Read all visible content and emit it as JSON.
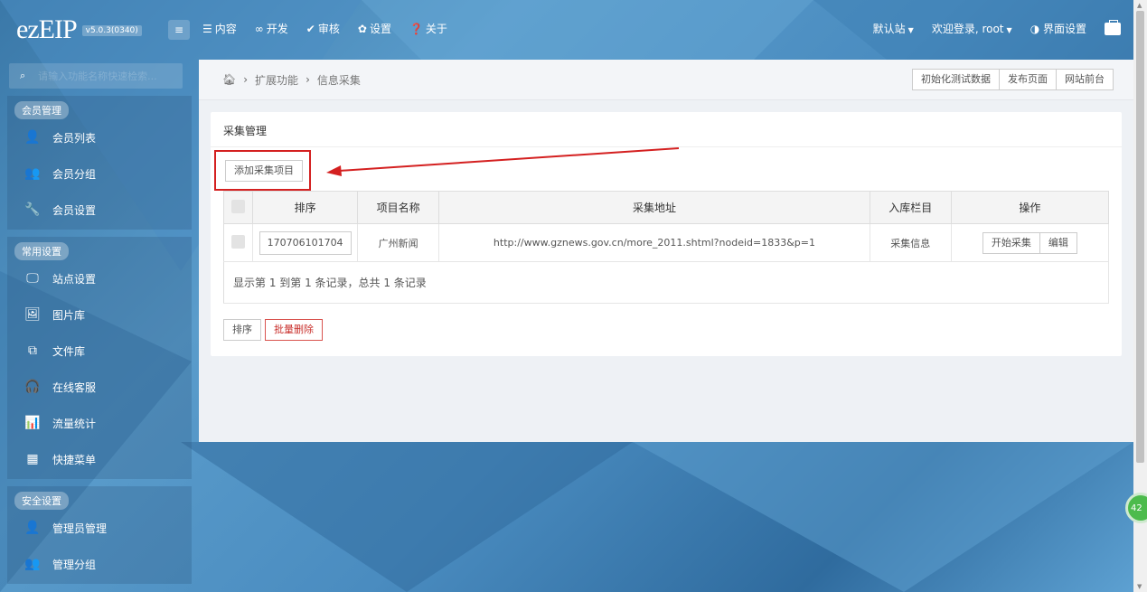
{
  "header": {
    "logo": "ezEIP",
    "version": "v5.0.3(0340)",
    "nav": [
      {
        "icon": "list-icon",
        "glyph": "☰",
        "label": "内容"
      },
      {
        "icon": "infinity-icon",
        "glyph": "∞",
        "label": "开发"
      },
      {
        "icon": "check-icon",
        "glyph": "✔",
        "label": "审核"
      },
      {
        "icon": "gear-icon",
        "glyph": "✿",
        "label": "设置"
      },
      {
        "icon": "question-icon",
        "glyph": "❓",
        "label": "关于"
      }
    ],
    "site": "默认站",
    "welcome": "欢迎登录, root",
    "ui_settings": "界面设置"
  },
  "sidebar": {
    "search_placeholder": "请输入功能名称快速检索...",
    "groups": [
      {
        "label": "会员管理",
        "items": [
          {
            "icon": "user-icon",
            "label": "会员列表"
          },
          {
            "icon": "users-icon",
            "label": "会员分组"
          },
          {
            "icon": "wrench-icon",
            "label": "会员设置"
          }
        ]
      },
      {
        "label": "常用设置",
        "items": [
          {
            "icon": "monitor-icon",
            "label": "站点设置"
          },
          {
            "icon": "image-icon",
            "label": "图片库"
          },
          {
            "icon": "files-icon",
            "label": "文件库"
          },
          {
            "icon": "headset-icon",
            "label": "在线客服"
          },
          {
            "icon": "bar-chart-icon",
            "label": "流量统计"
          },
          {
            "icon": "grid-icon",
            "label": "快捷菜单"
          }
        ]
      },
      {
        "label": "安全设置",
        "items": [
          {
            "icon": "user-icon",
            "label": "管理员管理"
          },
          {
            "icon": "users-icon",
            "label": "管理分组"
          }
        ]
      }
    ]
  },
  "breadcrumb": {
    "items": [
      "扩展功能",
      "信息采集"
    ]
  },
  "top_actions": [
    "初始化测试数据",
    "发布页面",
    "网站前台"
  ],
  "panel": {
    "title": "采集管理",
    "add_button": "添加采集项目",
    "columns": [
      "排序",
      "项目名称",
      "采集地址",
      "入库栏目",
      "操作"
    ],
    "rows": [
      {
        "sort": "170706101704",
        "name": "广州新闻",
        "url": "http://www.gznews.gov.cn/more_2011.shtml?nodeid=1833&p=1",
        "category": "采集信息",
        "actions": [
          "开始采集",
          "编辑"
        ]
      }
    ],
    "summary": "显示第 1 到第 1 条记录，总共 1 条记录",
    "sort_button": "排序",
    "batch_delete_button": "批量删除"
  },
  "colors": {
    "highlight_red": "#d42020",
    "danger": "#d9534f",
    "float_button": "#4cbb4c"
  },
  "float_button_label": "42"
}
